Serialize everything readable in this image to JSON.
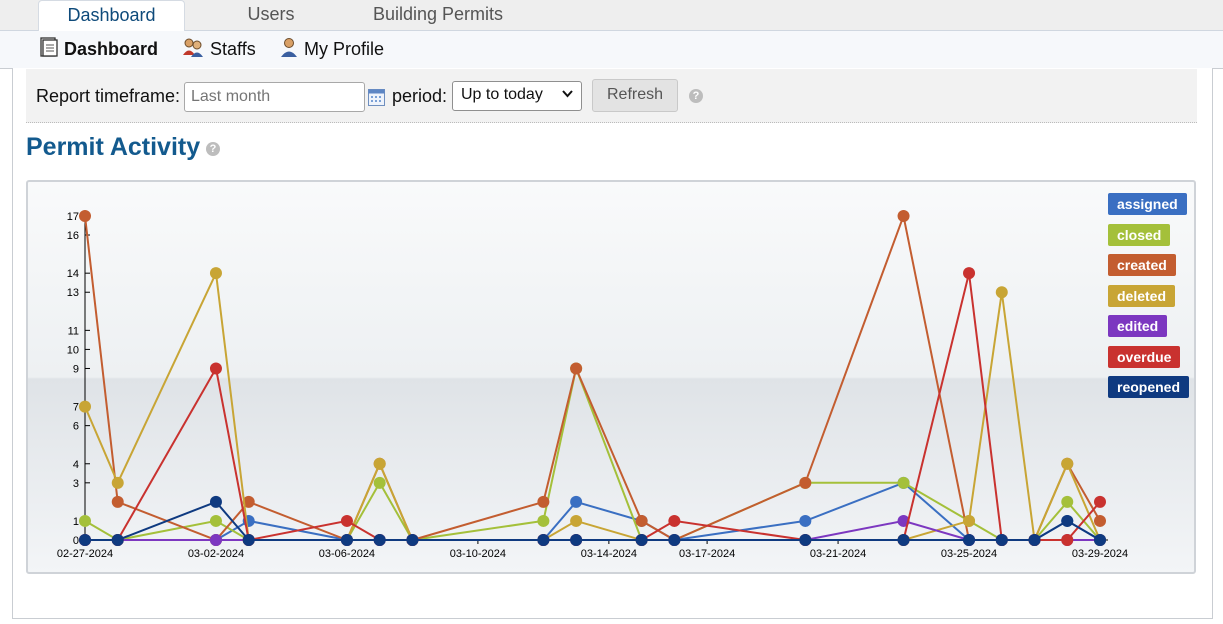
{
  "tabs": [
    {
      "label": "Dashboard",
      "active": true
    },
    {
      "label": "Users",
      "active": false
    },
    {
      "label": "Building Permits",
      "active": false
    }
  ],
  "subnav": [
    {
      "label": "Dashboard",
      "icon": "document-icon",
      "active": true
    },
    {
      "label": "Staffs",
      "icon": "users-icon",
      "active": false
    },
    {
      "label": "My Profile",
      "icon": "user-icon",
      "active": false
    }
  ],
  "filter": {
    "timeframe_label": "Report timeframe:",
    "timeframe_placeholder": "Last month",
    "period_label": "period:",
    "period_value": "Up to today",
    "refresh_label": "Refresh"
  },
  "section_title": "Permit Activity",
  "colors": {
    "assigned": "#3a6fc2",
    "closed": "#a4c03a",
    "created": "#c35d30",
    "deleted": "#c8a535",
    "edited": "#7c37c0",
    "overdue": "#c9322f",
    "reopened": "#0f3a80"
  },
  "chart_data": {
    "type": "line",
    "x": [
      "02-27-2024",
      "02-28-2024",
      "03-02-2024",
      "03-03-2024",
      "03-06-2024",
      "03-07-2024",
      "03-08-2024",
      "03-12-2024",
      "03-13-2024",
      "03-15-2024",
      "03-16-2024",
      "03-20-2024",
      "03-23-2024",
      "03-25-2024",
      "03-26-2024",
      "03-27-2024",
      "03-28-2024",
      "03-29-2024"
    ],
    "x_tick_labels": [
      "02-27-2024",
      "03-02-2024",
      "03-06-2024",
      "03-10-2024",
      "03-14-2024",
      "03-17-2024",
      "03-21-2024",
      "03-25-2024",
      "03-29-2024"
    ],
    "y_ticks": [
      0,
      1,
      3,
      4,
      6,
      7,
      9,
      10,
      11,
      13,
      14,
      16,
      17
    ],
    "ylim": [
      0,
      17
    ],
    "legend_position": "top-right",
    "series": [
      {
        "name": "assigned",
        "values": [
          0,
          0,
          0,
          1,
          0,
          0,
          0,
          0,
          2,
          1,
          0,
          1,
          3,
          0,
          0,
          0,
          1,
          0
        ]
      },
      {
        "name": "closed",
        "values": [
          1,
          0,
          1,
          0,
          0,
          3,
          0,
          1,
          9,
          0,
          0,
          3,
          3,
          1,
          0,
          0,
          2,
          0
        ]
      },
      {
        "name": "created",
        "values": [
          17,
          2,
          0,
          2,
          0,
          4,
          0,
          2,
          9,
          1,
          0,
          3,
          17,
          0,
          0,
          0,
          4,
          1
        ]
      },
      {
        "name": "deleted",
        "values": [
          7,
          3,
          14,
          0,
          0,
          4,
          0,
          0,
          1,
          0,
          0,
          0,
          0,
          1,
          13,
          0,
          4,
          0
        ]
      },
      {
        "name": "edited",
        "values": [
          0,
          0,
          0,
          0,
          0,
          0,
          0,
          0,
          0,
          0,
          0,
          0,
          1,
          0,
          0,
          0,
          0,
          0
        ]
      },
      {
        "name": "overdue",
        "values": [
          0,
          0,
          9,
          0,
          1,
          0,
          0,
          0,
          0,
          0,
          1,
          0,
          0,
          14,
          0,
          0,
          0,
          2
        ]
      },
      {
        "name": "reopened",
        "values": [
          0,
          0,
          2,
          0,
          0,
          0,
          0,
          0,
          0,
          0,
          0,
          0,
          0,
          0,
          0,
          0,
          1,
          0
        ]
      }
    ]
  }
}
